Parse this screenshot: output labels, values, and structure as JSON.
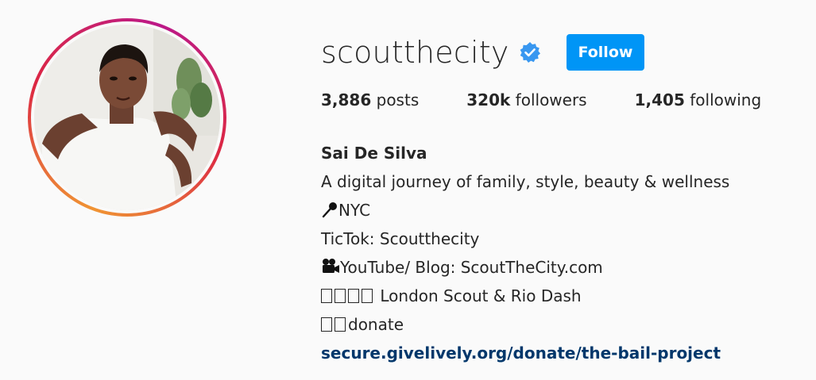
{
  "profile": {
    "username": "scoutthecity",
    "follow_label": "Follow",
    "verified": true,
    "avatar_icon": "profile-photo"
  },
  "stats": {
    "posts_count": "3,886",
    "posts_label": "posts",
    "followers_count": "320k",
    "followers_label": "followers",
    "following_count": "1,405",
    "following_label": "following"
  },
  "bio": {
    "full_name": "Sai De Silva",
    "line1": "A digital journey of family, style, beauty & wellness",
    "line2": "NYC",
    "line3": "TicTok: Scoutthecity",
    "line4": "YouTube/ Blog: ScoutTheCity.com",
    "line5": "London Scout & Rio Dash",
    "line6": "donate",
    "link": "secure.givelively.org/donate/the-bail-project"
  },
  "colors": {
    "accent": "#0095f6",
    "link": "#00376b",
    "text": "#262626",
    "background": "#fafafa",
    "verified": "#3897f0"
  }
}
